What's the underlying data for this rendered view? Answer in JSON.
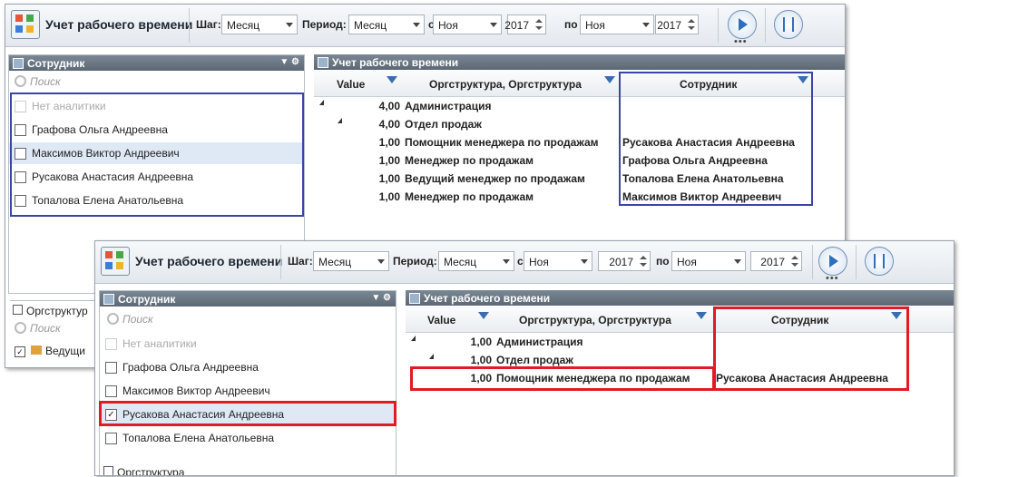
{
  "back": {
    "title": "Учет рабочего времени",
    "step_label": "Шаг:",
    "step_value": "Месяц",
    "period_label": "Период:",
    "period_value": "Месяц",
    "from_label": "с",
    "from_month": "Ноя",
    "from_year": "2017",
    "to_label": "по",
    "to_month": "Ноя",
    "to_year": "2017",
    "dots": "•••",
    "left_panel": {
      "title": "Сотрудник",
      "search_placeholder": "Поиск",
      "items": [
        {
          "label": "Нет аналитики"
        },
        {
          "label": "Графова Ольга  Андреевна"
        },
        {
          "label": "Максимов Виктор Андреевич"
        },
        {
          "label": "Русакова Анастасия Андреевна"
        },
        {
          "label": "Топалова Елена Анатольевна"
        }
      ],
      "section2_title": "Оргструктур",
      "section2_search": "Поиск",
      "section2_item": "Ведущи"
    },
    "grid": {
      "title": "Учет рабочего времени",
      "col_value": "Value",
      "col_org": "Оргструктура, Оргструктура",
      "col_emp": "Сотрудник",
      "rows": [
        {
          "value": "4,00",
          "org": "Администрация",
          "emp": ""
        },
        {
          "value": "4,00",
          "org": "Отдел продаж",
          "emp": ""
        },
        {
          "value": "1,00",
          "org": "Помощник менеджера по продажам",
          "emp": "Русакова Анастасия Андреевна"
        },
        {
          "value": "1,00",
          "org": "Менеджер по продажам",
          "emp": "Графова Ольга Андреевна"
        },
        {
          "value": "1,00",
          "org": "Ведущий менеджер по продажам",
          "emp": "Топалова Елена Анатольевна"
        },
        {
          "value": "1,00",
          "org": "Менеджер по продажам",
          "emp": "Максимов Виктор Андреевич"
        }
      ]
    }
  },
  "front": {
    "title": "Учет рабочего времени",
    "step_label": "Шаг:",
    "step_value": "Месяц",
    "period_label": "Период:",
    "period_value": "Месяц",
    "from_label": "с",
    "from_month": "Ноя",
    "from_year": "2017",
    "to_label": "по",
    "to_month": "Ноя",
    "to_year": "2017",
    "dots": "•••",
    "left_panel": {
      "title": "Сотрудник",
      "search_placeholder": "Поиск",
      "items": [
        {
          "label": "Нет аналитики"
        },
        {
          "label": "Графова Ольга  Андреевна"
        },
        {
          "label": "Максимов Виктор Андреевич"
        },
        {
          "label": "Русакова Анастасия Андреевна"
        },
        {
          "label": "Топалова Елена Анатольевна"
        }
      ],
      "section2_title": "Оргструктура"
    },
    "grid": {
      "title": "Учет рабочего времени",
      "col_value": "Value",
      "col_org": "Оргструктура, Оргструктура",
      "col_emp": "Сотрудник",
      "rows": [
        {
          "value": "1,00",
          "org": "Администрация",
          "emp": ""
        },
        {
          "value": "1,00",
          "org": "Отдел продаж",
          "emp": ""
        },
        {
          "value": "1,00",
          "org": "Помощник менеджера по продажам",
          "emp": "Русакова Анастасия Андреевна"
        }
      ]
    }
  },
  "colors": {
    "highlight_blue": "#3b45a8",
    "highlight_red": "#e01b24",
    "accent": "#2f6fc0"
  },
  "icons": [
    "app-icon",
    "play-icon",
    "settings-icon",
    "filter-icon",
    "search-icon",
    "checkbox-icon"
  ]
}
